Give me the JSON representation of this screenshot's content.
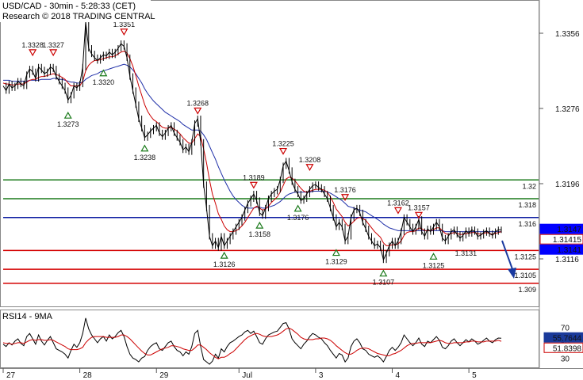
{
  "header": {
    "line1": "USD/CAD - 30min - 5:28:33 (CET)",
    "line2": "Research © 2018 TRADING CENTRAL"
  },
  "rsi_header": "RSI14 - 9MA",
  "colors": {
    "price": "#000000",
    "ma_fast": "#cc0000",
    "ma_slow": "#1f2fa8",
    "support": "#d40000",
    "resistance": "#1a7a1a",
    "pivot": "#0a1aa0",
    "down_marker": "#cc0000",
    "up_marker": "#1a7a1a",
    "price_tag": "#0000ff",
    "price_tag_alt": "#cc0000",
    "rsi_tag": "#1a3a9a"
  },
  "chart_data": [
    {
      "type": "line",
      "name": "USD/CAD 30min",
      "ylim": [
        1.3068,
        1.3388
      ],
      "y_ticks": [
        1.3356,
        1.3276,
        1.3196,
        1.3116
      ],
      "x_labels": [
        "27",
        "28",
        "29",
        "Jul",
        "3",
        "4",
        "5"
      ],
      "x_label_positions": [
        0,
        26,
        52,
        80,
        106,
        132,
        158
      ],
      "x_count": 170,
      "price": [
        1.33,
        1.3295,
        1.3302,
        1.3298,
        1.33,
        1.3305,
        1.3302,
        1.33,
        1.3312,
        1.3318,
        1.3315,
        1.3308,
        1.332,
        1.3317,
        1.3313,
        1.3315,
        1.332,
        1.3318,
        1.331,
        1.3305,
        1.33,
        1.3295,
        1.3285,
        1.329,
        1.33,
        1.3298,
        1.3302,
        1.332,
        1.3368,
        1.334,
        1.3334,
        1.333,
        1.3327,
        1.333,
        1.3333,
        1.3332,
        1.3336,
        1.3333,
        1.3336,
        1.334,
        1.3345,
        1.3342,
        1.333,
        1.331,
        1.3295,
        1.328,
        1.3265,
        1.3255,
        1.3245,
        1.3248,
        1.3252,
        1.3255,
        1.3258,
        1.325,
        1.3246,
        1.325,
        1.3255,
        1.3258,
        1.325,
        1.3245,
        1.324,
        1.3232,
        1.3235,
        1.323,
        1.324,
        1.326,
        1.3265,
        1.324,
        1.3195,
        1.317,
        1.314,
        1.313,
        1.3135,
        1.3128,
        1.314,
        1.313,
        1.3135,
        1.314,
        1.3145,
        1.315,
        1.3155,
        1.316,
        1.3168,
        1.3175,
        1.318,
        1.3185,
        1.3178,
        1.3165,
        1.3162,
        1.317,
        1.318,
        1.3185,
        1.3188,
        1.319,
        1.32,
        1.3215,
        1.322,
        1.321,
        1.3198,
        1.319,
        1.3185,
        1.3178,
        1.318,
        1.3185,
        1.319,
        1.3194,
        1.3195,
        1.3192,
        1.319,
        1.3185,
        1.318,
        1.317,
        1.316,
        1.315,
        1.3155,
        1.315,
        1.3135,
        1.314,
        1.316,
        1.3168,
        1.317,
        1.3165,
        1.3155,
        1.3148,
        1.314,
        1.3135,
        1.313,
        1.3132,
        1.3128,
        1.3115,
        1.3122,
        1.313,
        1.3135,
        1.313,
        1.3135,
        1.3145,
        1.316,
        1.3155,
        1.315,
        1.3145,
        1.315,
        1.3158,
        1.3145,
        1.314,
        1.3148,
        1.3145,
        1.315,
        1.3155,
        1.315,
        1.3138,
        1.3135,
        1.314,
        1.3145,
        1.3147,
        1.3142,
        1.3138,
        1.3141,
        1.3146,
        1.3143,
        1.3147,
        1.3145,
        1.314,
        1.3141,
        1.3144,
        1.3146,
        1.3143,
        1.3141,
        1.3145,
        1.3147,
        1.3147
      ],
      "ma_fast": [
        1.3303,
        1.3302,
        1.3302,
        1.3301,
        1.3301,
        1.3302,
        1.3302,
        1.3302,
        1.3304,
        1.3306,
        1.3307,
        1.3307,
        1.3309,
        1.331,
        1.331,
        1.3311,
        1.3312,
        1.3313,
        1.3312,
        1.3311,
        1.3309,
        1.3307,
        1.3303,
        1.33,
        1.33,
        1.33,
        1.33,
        1.3305,
        1.3316,
        1.3322,
        1.3325,
        1.3327,
        1.3327,
        1.3328,
        1.3329,
        1.333,
        1.3331,
        1.3331,
        1.3332,
        1.3334,
        1.3336,
        1.3337,
        1.3335,
        1.3329,
        1.3321,
        1.3311,
        1.33,
        1.329,
        1.328,
        1.3273,
        1.3268,
        1.3264,
        1.3262,
        1.3259,
        1.3256,
        1.3255,
        1.3255,
        1.3256,
        1.3254,
        1.3252,
        1.3249,
        1.3245,
        1.3242,
        1.3239,
        1.3239,
        1.3244,
        1.3249,
        1.3246,
        1.3233,
        1.3218,
        1.32,
        1.3185,
        1.3175,
        1.3164,
        1.3158,
        1.3151,
        1.3147,
        1.3145,
        1.3145,
        1.3146,
        1.3148,
        1.3151,
        1.3155,
        1.316,
        1.3165,
        1.317,
        1.3172,
        1.317,
        1.3168,
        1.3169,
        1.3172,
        1.3176,
        1.3179,
        1.3182,
        1.3187,
        1.3194,
        1.3201,
        1.3203,
        1.3202,
        1.3199,
        1.3195,
        1.3191,
        1.3188,
        1.3187,
        1.3188,
        1.3189,
        1.319,
        1.319,
        1.319,
        1.3189,
        1.3187,
        1.3182,
        1.3176,
        1.3169,
        1.3165,
        1.3161,
        1.3155,
        1.3151,
        1.3153,
        1.3156,
        1.3159,
        1.316,
        1.3159,
        1.3157,
        1.3153,
        1.3149,
        1.3145,
        1.3142,
        1.3139,
        1.3133,
        1.313,
        1.313,
        1.3131,
        1.3131,
        1.3132,
        1.3135,
        1.3141,
        1.3144,
        1.3145,
        1.3145,
        1.3146,
        1.3149,
        1.3148,
        1.3146,
        1.3146,
        1.3146,
        1.3147,
        1.3149,
        1.3149,
        1.3146,
        1.3143,
        1.3142,
        1.3143,
        1.3144,
        1.3143,
        1.3142,
        1.3142,
        1.3143,
        1.3143,
        1.3144,
        1.3144,
        1.3143,
        1.3142,
        1.3143,
        1.3144,
        1.3143,
        1.3142,
        1.3143,
        1.3144,
        1.3145
      ],
      "ma_slow": [
        1.3306,
        1.3306,
        1.3306,
        1.3305,
        1.3305,
        1.3305,
        1.3305,
        1.3305,
        1.3305,
        1.3306,
        1.3306,
        1.3306,
        1.3306,
        1.3307,
        1.3307,
        1.3307,
        1.3307,
        1.3308,
        1.3308,
        1.3307,
        1.3307,
        1.3306,
        1.3305,
        1.3304,
        1.3304,
        1.3303,
        1.3303,
        1.3304,
        1.3307,
        1.3309,
        1.3311,
        1.3312,
        1.3313,
        1.3315,
        1.3316,
        1.3317,
        1.3318,
        1.3319,
        1.332,
        1.3321,
        1.3322,
        1.3323,
        1.3322,
        1.332,
        1.3317,
        1.3313,
        1.3308,
        1.3303,
        1.3297,
        1.3292,
        1.3288,
        1.3284,
        1.3281,
        1.3278,
        1.3275,
        1.3272,
        1.327,
        1.3268,
        1.3266,
        1.3264,
        1.3262,
        1.3259,
        1.3257,
        1.3255,
        1.3253,
        1.3253,
        1.3253,
        1.3252,
        1.3248,
        1.3243,
        1.3236,
        1.3229,
        1.3222,
        1.3214,
        1.3207,
        1.32,
        1.3194,
        1.3188,
        1.3183,
        1.3179,
        1.3176,
        1.3173,
        1.3171,
        1.317,
        1.317,
        1.317,
        1.3171,
        1.3171,
        1.317,
        1.317,
        1.3171,
        1.3172,
        1.3173,
        1.3175,
        1.3177,
        1.318,
        1.3183,
        1.3185,
        1.3186,
        1.3187,
        1.3187,
        1.3187,
        1.3187,
        1.3187,
        1.3187,
        1.3188,
        1.3188,
        1.3188,
        1.3188,
        1.3188,
        1.3187,
        1.3186,
        1.3184,
        1.3182,
        1.318,
        1.3178,
        1.3175,
        1.3172,
        1.3171,
        1.317,
        1.3169,
        1.3168,
        1.3167,
        1.3166,
        1.3164,
        1.3162,
        1.316,
        1.3158,
        1.3156,
        1.3153,
        1.3151,
        1.3149,
        1.3148,
        1.3147,
        1.3146,
        1.3146,
        1.3146,
        1.3146,
        1.3146,
        1.3146,
        1.3146,
        1.3146,
        1.3146,
        1.3146,
        1.3146,
        1.3146,
        1.3146,
        1.3146,
        1.3146,
        1.3146,
        1.3145,
        1.3145,
        1.3145,
        1.3145,
        1.3145,
        1.3145,
        1.3145,
        1.3145,
        1.3145,
        1.3145,
        1.3145,
        1.3145,
        1.3145,
        1.3145,
        1.3145,
        1.3145,
        1.3145,
        1.3145,
        1.3145,
        1.3145
      ],
      "levels": [
        {
          "value": 1.32,
          "label": "1.32",
          "kind": "resistance"
        },
        {
          "value": 1.318,
          "label": "1.318",
          "kind": "resistance"
        },
        {
          "value": 1.316,
          "label": "1.316",
          "kind": "pivot"
        },
        {
          "value": 1.3125,
          "label": "1.3125",
          "kind": "support"
        },
        {
          "value": 1.3105,
          "label": "1.3105",
          "kind": "support"
        },
        {
          "value": 1.309,
          "label": "1.309",
          "kind": "support"
        }
      ],
      "annotations": [
        {
          "i": 10,
          "y": 1.333,
          "label": "1.3328",
          "dir": "down"
        },
        {
          "i": 17,
          "y": 1.333,
          "label": "1.3327",
          "dir": "down"
        },
        {
          "i": 41,
          "y": 1.3352,
          "label": "1.3351",
          "dir": "down"
        },
        {
          "i": 34,
          "y": 1.332,
          "label": "1.3320",
          "dir": "up"
        },
        {
          "i": 22,
          "y": 1.3275,
          "label": "1.3273",
          "dir": "up"
        },
        {
          "i": 66,
          "y": 1.3268,
          "label": "1.3268",
          "dir": "down"
        },
        {
          "i": 48,
          "y": 1.324,
          "label": "1.3238",
          "dir": "up"
        },
        {
          "i": 95,
          "y": 1.3225,
          "label": "1.3225",
          "dir": "down"
        },
        {
          "i": 104,
          "y": 1.3208,
          "label": "1.3208",
          "dir": "down"
        },
        {
          "i": 85,
          "y": 1.3189,
          "label": "1.3189",
          "dir": "down"
        },
        {
          "i": 116,
          "y": 1.3176,
          "label": "1.3176",
          "dir": "down"
        },
        {
          "i": 100,
          "y": 1.3176,
          "label": "1.3176",
          "dir": "up"
        },
        {
          "i": 87,
          "y": 1.3158,
          "label": "1.3158",
          "dir": "up"
        },
        {
          "i": 75,
          "y": 1.3126,
          "label": "1.3126",
          "dir": "up"
        },
        {
          "i": 113,
          "y": 1.3129,
          "label": "1.3129",
          "dir": "up"
        },
        {
          "i": 134,
          "y": 1.3162,
          "label": "1.3162",
          "dir": "down"
        },
        {
          "i": 141,
          "y": 1.3157,
          "label": "1.3157",
          "dir": "down"
        },
        {
          "i": 129,
          "y": 1.3107,
          "label": "1.3107",
          "dir": "up"
        },
        {
          "i": 146,
          "y": 1.3125,
          "label": "1.3125",
          "dir": "up"
        },
        {
          "i": 157,
          "y": 1.3131,
          "label": "1.3131",
          "dir": "none"
        }
      ],
      "price_tags": [
        {
          "value": 1.3147,
          "label": "1.3147",
          "kind": "last"
        },
        {
          "value": 1.31415,
          "label": "1.31415",
          "kind": "alt"
        },
        {
          "value": 1.3141,
          "label": "1.3141",
          "kind": "last"
        }
      ]
    },
    {
      "type": "line",
      "name": "RSI14 - 9MA",
      "ylim": [
        20,
        90
      ],
      "y_ticks": [
        70,
        50,
        30
      ],
      "rsi_tags": [
        {
          "value": 55.7644,
          "label": "55.7644",
          "kind": "rsi"
        },
        {
          "value": 51.8398,
          "label": "51.8398",
          "kind": "ma"
        }
      ],
      "rsi": [
        48,
        45,
        50,
        47,
        52,
        55,
        49,
        46,
        58,
        62,
        55,
        48,
        60,
        52,
        47,
        53,
        58,
        50,
        42,
        40,
        38,
        35,
        30,
        40,
        48,
        44,
        50,
        62,
        82,
        68,
        60,
        55,
        50,
        55,
        58,
        52,
        60,
        55,
        58,
        63,
        66,
        58,
        45,
        35,
        30,
        28,
        25,
        30,
        32,
        40,
        45,
        48,
        50,
        42,
        40,
        45,
        50,
        52,
        45,
        40,
        38,
        33,
        38,
        35,
        45,
        62,
        66,
        45,
        28,
        25,
        22,
        26,
        35,
        30,
        42,
        38,
        45,
        50,
        52,
        55,
        58,
        60,
        64,
        66,
        62,
        65,
        58,
        50,
        48,
        55,
        60,
        62,
        64,
        65,
        70,
        75,
        76,
        68,
        55,
        50,
        46,
        42,
        48,
        52,
        58,
        62,
        60,
        57,
        55,
        50,
        46,
        40,
        35,
        30,
        36,
        34,
        25,
        30,
        45,
        52,
        55,
        50,
        42,
        40,
        35,
        33,
        31,
        33,
        30,
        25,
        32,
        40,
        44,
        40,
        44,
        50,
        60,
        55,
        50,
        46,
        50,
        56,
        48,
        45,
        52,
        50,
        54,
        58,
        53,
        44,
        42,
        46,
        52,
        55,
        50,
        46,
        50,
        54,
        51,
        55,
        52,
        48,
        50,
        53,
        56,
        52,
        50,
        54,
        56,
        55.76
      ],
      "rsi_ma": [
        50,
        49,
        49,
        48,
        49,
        50,
        50,
        49,
        51,
        53,
        54,
        53,
        54,
        54,
        53,
        53,
        54,
        53,
        51,
        49,
        47,
        45,
        42,
        41,
        41,
        41,
        42,
        44,
        50,
        54,
        57,
        58,
        58,
        58,
        58,
        57,
        57,
        57,
        57,
        58,
        60,
        60,
        58,
        55,
        51,
        47,
        43,
        39,
        36,
        34,
        34,
        36,
        38,
        40,
        42,
        43,
        44,
        46,
        46,
        45,
        44,
        42,
        41,
        40,
        40,
        43,
        47,
        47,
        44,
        41,
        37,
        34,
        31,
        29,
        31,
        31,
        33,
        36,
        38,
        42,
        46,
        50,
        54,
        57,
        59,
        61,
        62,
        61,
        59,
        58,
        58,
        58,
        59,
        60,
        62,
        65,
        68,
        69,
        67,
        64,
        61,
        57,
        55,
        54,
        54,
        54,
        55,
        55,
        56,
        56,
        55,
        53,
        50,
        46,
        43,
        40,
        37,
        35,
        35,
        37,
        40,
        42,
        43,
        43,
        42,
        40,
        38,
        36,
        35,
        34,
        33,
        33,
        35,
        36,
        38,
        40,
        43,
        46,
        48,
        49,
        49,
        50,
        50,
        50,
        50,
        50,
        51,
        52,
        53,
        52,
        50,
        49,
        49,
        50,
        50,
        50,
        50,
        51,
        51,
        52,
        52,
        51,
        51,
        51,
        52,
        52,
        52,
        52,
        53,
        51.84
      ]
    }
  ]
}
